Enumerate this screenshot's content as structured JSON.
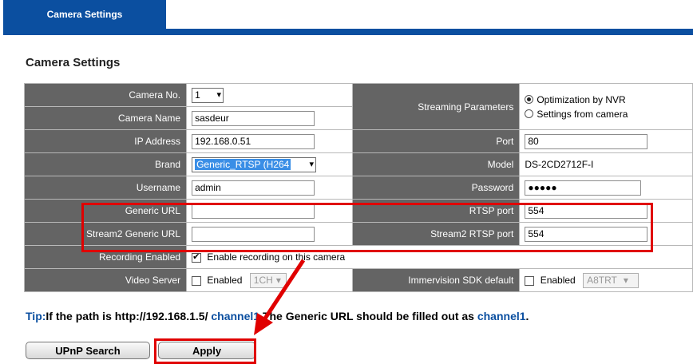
{
  "tabs": {
    "active": "Camera Settings"
  },
  "section_title": "Camera Settings",
  "form": {
    "camera_no": {
      "label": "Camera No.",
      "value": "1"
    },
    "camera_name": {
      "label": "Camera Name",
      "value": "sasdeur"
    },
    "ip_address": {
      "label": "IP Address",
      "value": "192.168.0.51"
    },
    "brand": {
      "label": "Brand",
      "value": "Generic_RTSP (H264"
    },
    "username": {
      "label": "Username",
      "value": "admin"
    },
    "generic_url": {
      "label": "Generic URL",
      "value": ""
    },
    "stream2_generic_url": {
      "label": "Stream2 Generic URL",
      "value": ""
    },
    "recording_enabled": {
      "label": "Recording Enabled",
      "checked": true,
      "text": "Enable recording on this camera"
    },
    "video_server": {
      "label": "Video Server",
      "checked": false,
      "text": "Enabled",
      "select": "1CH"
    },
    "streaming_parameters": {
      "label": "Streaming Parameters",
      "option1": "Optimization by NVR",
      "option2": "Settings from camera",
      "selected": "Optimization by NVR"
    },
    "port": {
      "label": "Port",
      "value": "80"
    },
    "model": {
      "label": "Model",
      "value": "DS-2CD2712F-I"
    },
    "password": {
      "label": "Password",
      "value": "●●●●●"
    },
    "rtsp_port": {
      "label": "RTSP port",
      "value": "554"
    },
    "stream2_rtsp_port": {
      "label": "Stream2 RTSP port",
      "value": "554"
    },
    "immervision": {
      "label": "Immervision SDK default",
      "checked": false,
      "text": "Enabled",
      "select": "A8TRT"
    }
  },
  "tip": {
    "prefix": "Tip:",
    "text1": "If the path is http://192.168.1.5/ ",
    "link1": "channel1",
    "text2": ".The Generic URL should be filled out as ",
    "link2": "channel1",
    "text3": "."
  },
  "buttons": {
    "upnp": "UPnP Search",
    "apply": "Apply"
  },
  "colors": {
    "brand_blue": "#0b4fa0",
    "label_bg": "#646464",
    "annotation_red": "#e00000"
  }
}
